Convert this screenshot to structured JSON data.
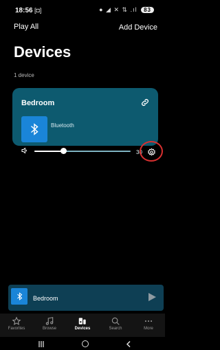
{
  "status_bar": {
    "time": "18:56",
    "cast": "[◘]",
    "icons": "● ◢ ✕ ⇅ .ıl",
    "battery": "83"
  },
  "header": {
    "play_all": "Play All",
    "add_device": "Add Device",
    "title": "Devices",
    "device_count": "1 device"
  },
  "device_card": {
    "room": "Bedroom",
    "source": "Bluetooth",
    "volume_value": "30",
    "volume_fraction": 0.3,
    "colors": {
      "card_bg": "#0d5a6f",
      "thumb_bg": "#1a85d8",
      "highlight_ring": "#d93030"
    }
  },
  "now_playing": {
    "label": "Bedroom"
  },
  "bottom_nav": {
    "items": [
      {
        "label": "Favorites",
        "icon": "star-icon",
        "active": false
      },
      {
        "label": "Browse",
        "icon": "music-note-icon",
        "active": false
      },
      {
        "label": "Devices",
        "icon": "speaker-icon",
        "active": true
      },
      {
        "label": "Search",
        "icon": "search-icon",
        "active": false
      },
      {
        "label": "More",
        "icon": "more-dots-icon",
        "active": false
      }
    ]
  }
}
